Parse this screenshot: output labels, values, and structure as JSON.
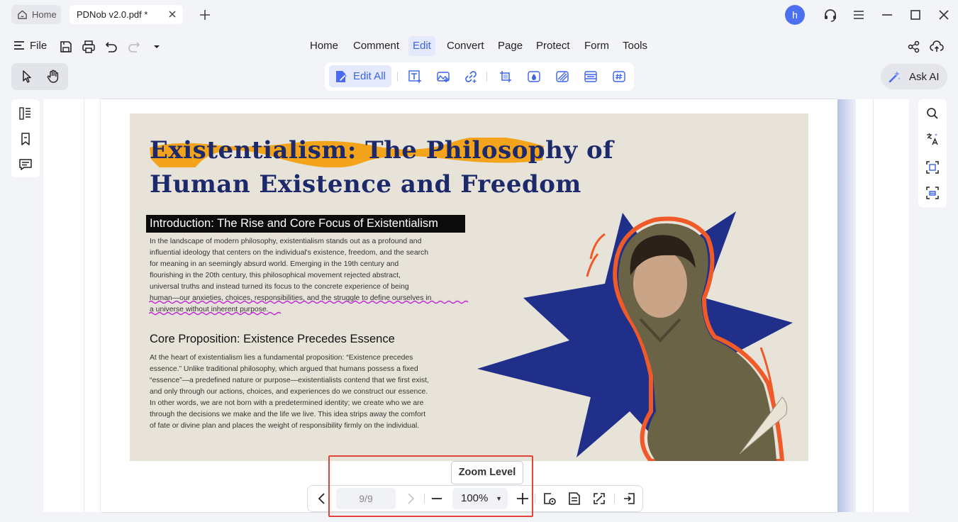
{
  "titlebar": {
    "tabs": [
      {
        "label": "Home",
        "icon": "home-icon"
      },
      {
        "label": "PDNob v2.0.pdf *",
        "icon": "close-icon"
      }
    ],
    "new_tab_icon": "plus-icon",
    "user_initial": "h",
    "window_controls": [
      "support-headset-icon",
      "hamburger-menu-icon",
      "minimize-icon",
      "maximize-icon",
      "close-icon"
    ]
  },
  "menubar": {
    "file_label": "File",
    "quick_actions": [
      "save-icon",
      "print-icon",
      "undo-icon",
      "redo-icon",
      "dropdown-caret-icon"
    ],
    "items": [
      "Home",
      "Comment",
      "Edit",
      "Convert",
      "Page",
      "Protect",
      "Form",
      "Tools"
    ],
    "active_item": "Edit",
    "right_icons": [
      "share-icon",
      "cloud-upload-icon"
    ]
  },
  "toolbar": {
    "mode_tools": [
      "select-cursor-icon",
      "hand-pan-icon"
    ],
    "edit_all_label": "Edit All",
    "edit_tools": [
      "add-text-icon",
      "add-image-icon",
      "add-link-icon",
      "crop-icon",
      "watermark-icon",
      "background-icon",
      "header-footer-icon",
      "bates-number-icon"
    ],
    "ask_ai_label": "Ask AI"
  },
  "left_sidebar": [
    "thumbnails-icon",
    "bookmark-icon",
    "comments-icon"
  ],
  "right_sidebar": [
    "search-icon",
    "translate-icon",
    "ocr-icon",
    "screenshot-icon"
  ],
  "document": {
    "title_line1": "Existentialism: The Philosophy of",
    "title_line2": "Human Existence and Freedom",
    "intro_heading": "Introduction: The Rise and Core Focus of Existentialism",
    "intro_lines": [
      "In the landscape of modern philosophy, existentialism stands out as a profound and",
      "influential ideology that centers on the individual's existence, freedom, and the search",
      "for meaning in an seemingly absurd world. Emerging in the 19th century and",
      "flourishing in the 20th century, this philosophical movement rejected abstract,",
      "universal truths and instead turned its focus to the concrete experience of being",
      "human—our anxieties, choices, responsibilities, and the struggle to define ourselves in",
      "a universe without inherent purpose."
    ],
    "core_heading": "Core Proposition: Existence Precedes Essence",
    "core_lines": [
      " At the heart of existentialism lies a fundamental proposition: “Existence precedes",
      "essence.” Unlike traditional philosophy, which argued that humans possess a fixed",
      "“essence”—a predefined nature or purpose—existentialists contend that we first exist,",
      "and only through our actions, choices, and experiences do we construct our essence.",
      "In other words, we are not born with a predetermined identity; we create who we are",
      "through the decisions we make and the life we live. This idea strips away the comfort",
      "of fate or divine plan and places the weight of responsibility firmly on the individual."
    ],
    "colors": {
      "title": "#1c2a6b",
      "highlight": "#f59e0b",
      "underline": "#c026d3",
      "starburst": "#1f2f8a",
      "outline": "#f05a28"
    }
  },
  "bottom_bar": {
    "prev_icon": "chevron-left-icon",
    "page_indicator": "9/9",
    "next_icon": "chevron-right-icon",
    "zoom_out_icon": "minus-icon",
    "zoom_level": "100%",
    "zoom_in_icon": "plus-icon",
    "tools": [
      "fit-page-icon",
      "single-page-icon",
      "fullscreen-icon",
      "exit-icon"
    ],
    "tooltip": "Zoom Level"
  }
}
